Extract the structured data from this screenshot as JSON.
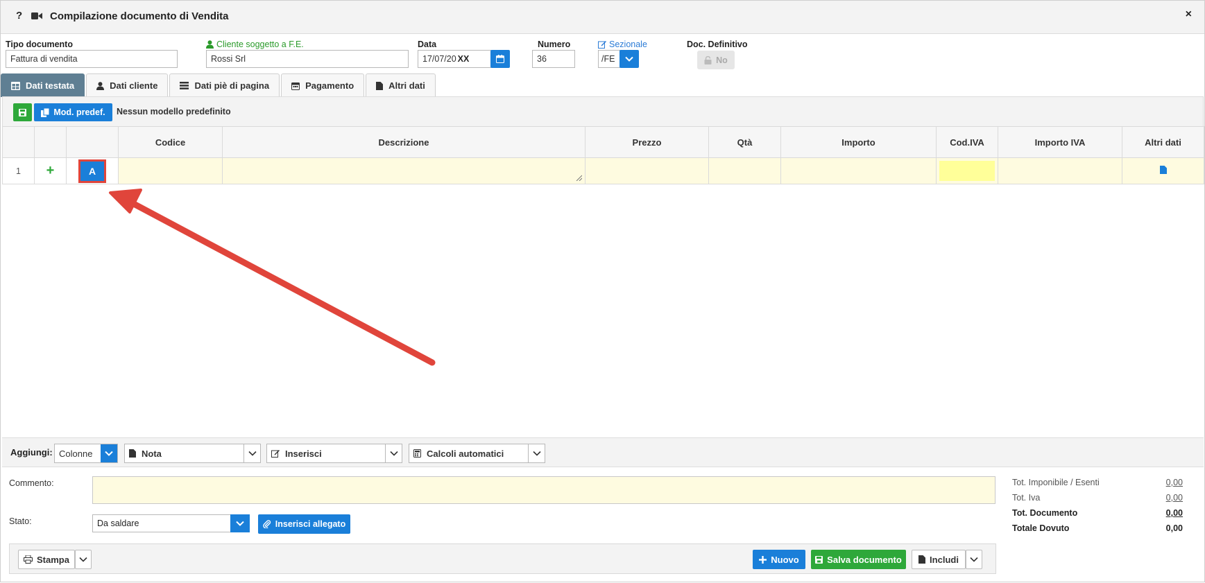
{
  "window": {
    "title": "Compilazione documento di Vendita",
    "help_glyph": "?",
    "close_glyph": "×"
  },
  "header": {
    "tipo_documento": {
      "label": "Tipo documento",
      "value": "Fattura di vendita"
    },
    "cliente": {
      "label": "Cliente soggetto a F.E.",
      "value": "Rossi Srl"
    },
    "data": {
      "label": "Data",
      "value": "17/07/20",
      "suffix": "XX"
    },
    "numero": {
      "label": "Numero",
      "value": "36"
    },
    "sezionale": {
      "label": "Sezionale",
      "value": "/FE"
    },
    "doc_definitivo": {
      "label": "Doc. Definitivo",
      "value": "No"
    }
  },
  "tabs": [
    {
      "label": "Dati testata",
      "icon": "table-icon",
      "active": true
    },
    {
      "label": "Dati cliente",
      "icon": "user-icon"
    },
    {
      "label": "Dati piè di pagina",
      "icon": "list-icon"
    },
    {
      "label": "Pagamento",
      "icon": "calendar-icon"
    },
    {
      "label": "Altri dati",
      "icon": "file-icon"
    }
  ],
  "toolbar": {
    "mod_predef_label": "Mod. predef.",
    "modello_text": "Nessun modello predefinito"
  },
  "grid": {
    "columns": [
      "",
      "",
      "",
      "Codice",
      "Descrizione",
      "Prezzo",
      "Qtà",
      "Importo",
      "Cod.IVA",
      "Importo IVA",
      "Altri dati"
    ],
    "rows": [
      {
        "num": "1",
        "plus": "+",
        "a_label": "A"
      }
    ]
  },
  "add_bar": {
    "label": "Aggiungi:",
    "colonne": "Colonne",
    "nota": "Nota",
    "inserisci": "Inserisci",
    "calcoli": "Calcoli automatici"
  },
  "footer": {
    "commento_label": "Commento:",
    "stato_label": "Stato:",
    "stato_value": "Da saldare",
    "allegato_label": "Inserisci allegato"
  },
  "totals": [
    {
      "label": "Tot. Imponibile / Esenti",
      "value": "0,00"
    },
    {
      "label": "Tot. Iva",
      "value": "0,00"
    },
    {
      "label": "Tot. Documento",
      "value": "0,00"
    },
    {
      "label": "Totale Dovuto",
      "value": "0,00"
    }
  ],
  "bottom": {
    "stampa": "Stampa",
    "nuovo": "Nuovo",
    "salva": "Salva documento",
    "includi": "Includi"
  },
  "colors": {
    "primary": "#1a7fd9",
    "success": "#2ea83a",
    "tab_active": "#5f7f93",
    "highlight": "#fefbe0",
    "arrow": "#e0453b"
  }
}
